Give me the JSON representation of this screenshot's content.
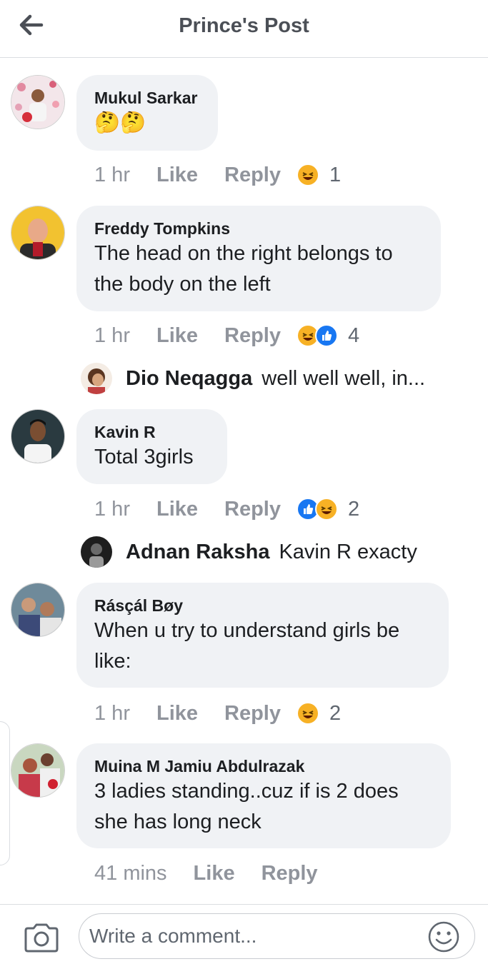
{
  "header": {
    "title": "Prince's Post",
    "back_icon": "arrow-left-icon"
  },
  "comments": [
    {
      "author": "Mukul Sarkar",
      "text": "🤔🤔",
      "time": "1 hr",
      "like": "Like",
      "reply": "Reply",
      "reactions": [
        "haha"
      ],
      "reaction_count": "1"
    },
    {
      "author": "Freddy Tompkins",
      "text": "The head on the right belongs to the body on the left",
      "time": "1 hr",
      "like": "Like",
      "reply": "Reply",
      "reactions": [
        "haha",
        "like"
      ],
      "reaction_count": "4",
      "reply_preview": {
        "author": "Dio Neqagga",
        "text": "well well well, in..."
      }
    },
    {
      "author": "Kavin R",
      "text": "Total 3girls",
      "time": "1 hr",
      "like": "Like",
      "reply": "Reply",
      "reactions": [
        "like",
        "haha"
      ],
      "reaction_count": "2",
      "reply_preview": {
        "author": "Adnan Raksha",
        "text": "Kavin R exacty"
      }
    },
    {
      "author": "Rásçál Bøy",
      "text": "When u try to understand girls be like:",
      "time": "1 hr",
      "like": "Like",
      "reply": "Reply",
      "reactions": [
        "haha"
      ],
      "reaction_count": "2"
    },
    {
      "author": "Muina M Jamiu Abdulrazak",
      "text": "3 ladies standing..cuz if is 2 does she has long neck",
      "time": "41 mins",
      "like": "Like",
      "reply": "Reply",
      "reactions": [],
      "reaction_count": ""
    }
  ],
  "composer": {
    "placeholder": "Write a comment...",
    "camera_icon": "camera-icon",
    "emoji_icon": "smiley-icon"
  },
  "colors": {
    "bubble": "#f0f2f5",
    "meta": "#90949c",
    "like_blue": "#1877f2",
    "haha_yellow": "#f7b125"
  }
}
